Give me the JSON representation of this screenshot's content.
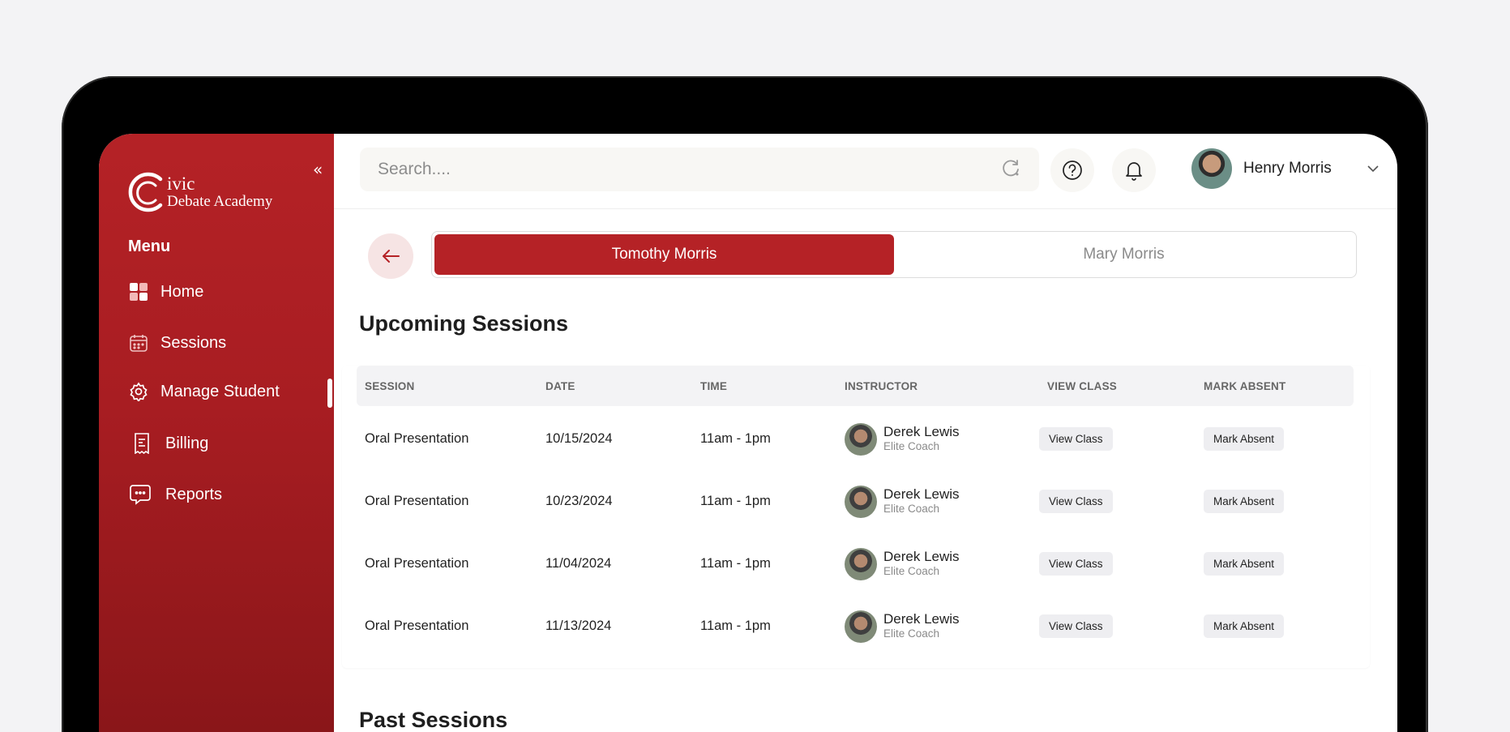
{
  "sidebar": {
    "logo": {
      "line1": "ivic",
      "line2": "Debate Academy"
    },
    "menu_title": "Menu",
    "items": [
      {
        "label": "Home"
      },
      {
        "label": "Sessions"
      },
      {
        "label": "Manage Student"
      },
      {
        "label": "Billing"
      },
      {
        "label": "Reports"
      }
    ]
  },
  "topbar": {
    "search_placeholder": "Search....",
    "user_name": "Henry Morris"
  },
  "tabs": [
    {
      "label": "Tomothy Morris",
      "active": true
    },
    {
      "label": "Mary Morris",
      "active": false
    }
  ],
  "upcoming": {
    "title": "Upcoming Sessions",
    "headers": [
      "SESSION",
      "DATE",
      "TIME",
      "INSTRUCTOR",
      "VIEW CLASS",
      "MARK ABSENT"
    ],
    "rows": [
      {
        "session": "Oral Presentation",
        "date": "10/15/2024",
        "time": "11am - 1pm",
        "instructor": "Derek Lewis",
        "role": "Elite Coach",
        "view": "View Class",
        "absent": "Mark Absent"
      },
      {
        "session": "Oral Presentation",
        "date": "10/23/2024",
        "time": "11am - 1pm",
        "instructor": "Derek Lewis",
        "role": "Elite Coach",
        "view": "View Class",
        "absent": "Mark Absent"
      },
      {
        "session": "Oral Presentation",
        "date": "11/04/2024",
        "time": "11am - 1pm",
        "instructor": "Derek Lewis",
        "role": "Elite Coach",
        "view": "View Class",
        "absent": "Mark Absent"
      },
      {
        "session": "Oral Presentation",
        "date": "11/13/2024",
        "time": "11am - 1pm",
        "instructor": "Derek Lewis",
        "role": "Elite Coach",
        "view": "View Class",
        "absent": "Mark Absent"
      }
    ]
  },
  "past": {
    "title": "Past Sessions"
  },
  "colors": {
    "brand": "#b52226",
    "brand_dark": "#8a1619",
    "pill_bg": "#eeeef1"
  },
  "icons": [
    "logo-mark",
    "collapse-icon",
    "home-icon",
    "calendar-icon",
    "gear-icon",
    "billing-icon",
    "chat-icon",
    "loading-icon",
    "help-icon",
    "bell-icon",
    "chevron-down-icon",
    "arrow-left-icon"
  ]
}
